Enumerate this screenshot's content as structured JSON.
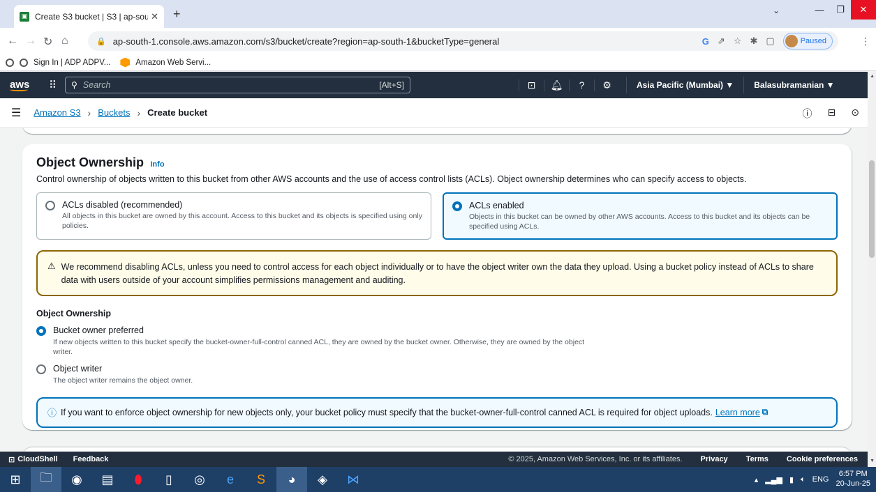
{
  "browser": {
    "tab_title": "Create S3 bucket | S3 | ap-south-",
    "url": "ap-south-1.console.aws.amazon.com/s3/bucket/create?region=ap-south-1&bucketType=general",
    "profile_status": "Paused",
    "bookmarks": [
      {
        "label": "Sign In | ADP ADPV..."
      },
      {
        "label": "Amazon Web Servi..."
      }
    ]
  },
  "aws_nav": {
    "logo": "aws",
    "search_placeholder": "Search",
    "search_shortcut": "[Alt+S]",
    "region": "Asia Pacific (Mumbai) ▼",
    "user": "Balasubramanian ▼"
  },
  "breadcrumb": {
    "items": [
      "Amazon S3",
      "Buckets"
    ],
    "current": "Create bucket"
  },
  "object_ownership": {
    "title": "Object Ownership",
    "info": "Info",
    "description": "Control ownership of objects written to this bucket from other AWS accounts and the use of access control lists (ACLs). Object ownership determines who can specify access to objects.",
    "tiles": [
      {
        "title": "ACLs disabled (recommended)",
        "description": "All objects in this bucket are owned by this account. Access to this bucket and its objects is specified using only policies.",
        "selected": false
      },
      {
        "title": "ACLs enabled",
        "description": "Objects in this bucket can be owned by other AWS accounts. Access to this bucket and its objects can be specified using ACLs.",
        "selected": true
      }
    ],
    "warning": "We recommend disabling ACLs, unless you need to control access for each object individually or to have the object writer own the data they upload. Using a bucket policy instead of ACLs to share data with users outside of your account simplifies permissions management and auditing.",
    "sub_label": "Object Ownership",
    "options": [
      {
        "title": "Bucket owner preferred",
        "description": "If new objects written to this bucket specify the bucket-owner-full-control canned ACL, they are owned by the bucket owner. Otherwise, they are owned by the object writer.",
        "selected": true
      },
      {
        "title": "Object writer",
        "description": "The object writer remains the object owner.",
        "selected": false
      }
    ],
    "info_box": "If you want to enforce object ownership for new objects only, your bucket policy must specify that the bucket-owner-full-control canned ACL is required for object uploads.",
    "learn_more": "Learn more"
  },
  "footer": {
    "cloudshell": "CloudShell",
    "feedback": "Feedback",
    "copyright": "© 2025, Amazon Web Services, Inc. or its affiliates.",
    "privacy": "Privacy",
    "terms": "Terms",
    "cookie": "Cookie preferences"
  },
  "taskbar": {
    "language": "ENG",
    "time": "6:57 PM",
    "date": "20-Jun-25"
  },
  "colors": {
    "aws_nav": "#232f3e",
    "link": "#0073bb",
    "warning_border": "#8d6605"
  }
}
